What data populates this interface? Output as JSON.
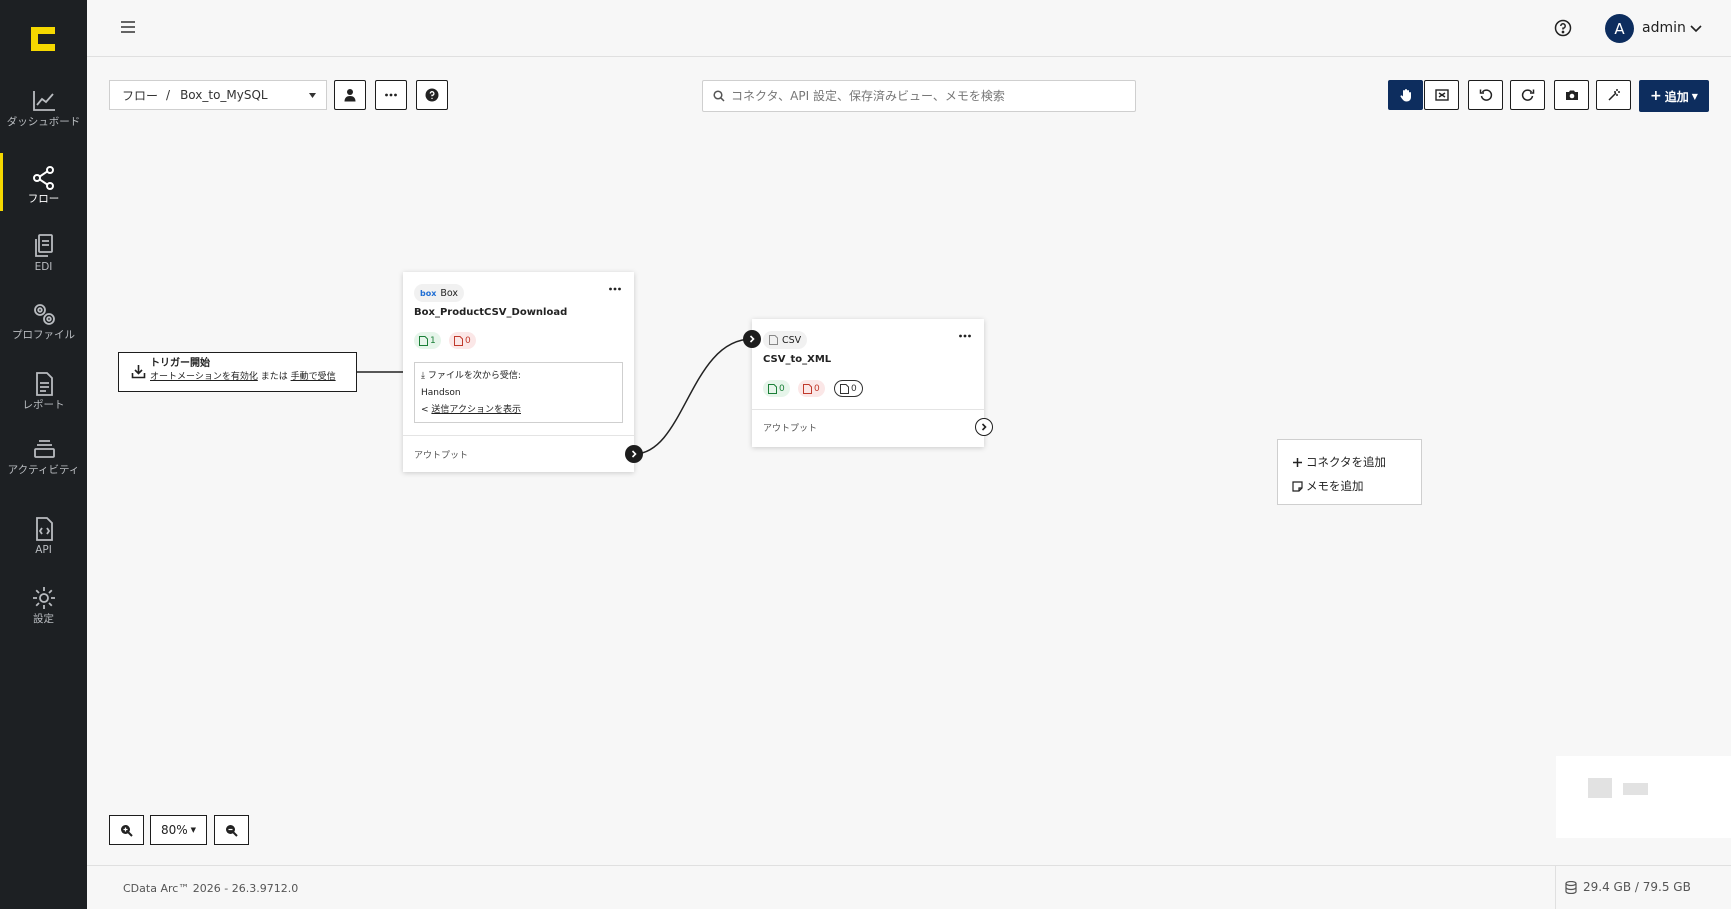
{
  "sidebar": {
    "items": [
      {
        "label": "ダッシュボード"
      },
      {
        "label": "フロー"
      },
      {
        "label": "EDI"
      },
      {
        "label": "プロファイル"
      },
      {
        "label": "レポート"
      },
      {
        "label": "アクティビティ"
      },
      {
        "label": "API"
      },
      {
        "label": "設定"
      }
    ],
    "active": "フロー"
  },
  "header": {
    "avatar_letter": "A",
    "username": "admin"
  },
  "toolbar": {
    "breadcrumb_root": "フロー",
    "breadcrumb_sep": "/",
    "flow_name": "Box_to_MySQL",
    "search_placeholder": "コネクタ、API 設定、保存済みビュー、メモを検索",
    "add_label": "追加"
  },
  "canvas": {
    "trigger": {
      "title": "トリガー開始",
      "link1": "オートメーションを有効化",
      "middle": "または",
      "link2": "手動で受信"
    },
    "node_box": {
      "type_label": "Box",
      "type_prefix": "box",
      "name": "Box_ProductCSV_Download",
      "success_count": "1",
      "error_count": "0",
      "receive_label": "ファイルを次から受信:",
      "receive_from": "Handson",
      "send_link": "送信アクションを表示",
      "output_label": "アウトプット"
    },
    "node_csv": {
      "type_label": "CSV",
      "name": "CSV_to_XML",
      "success_count": "0",
      "error_count": "0",
      "other_count": "0",
      "output_label": "アウトプット"
    },
    "context_menu": {
      "add_connector": "コネクタを追加",
      "add_memo": "メモを追加"
    }
  },
  "zoom": {
    "level": "80%"
  },
  "footer": {
    "version": "CData Arc™ 2026 - 26.3.9712.0",
    "storage": "29.4 GB / 79.5 GB"
  },
  "colors": {
    "sidebar_bg": "#1d2023",
    "accent_yellow": "#f5d800",
    "primary_navy": "#0d2d5e"
  }
}
